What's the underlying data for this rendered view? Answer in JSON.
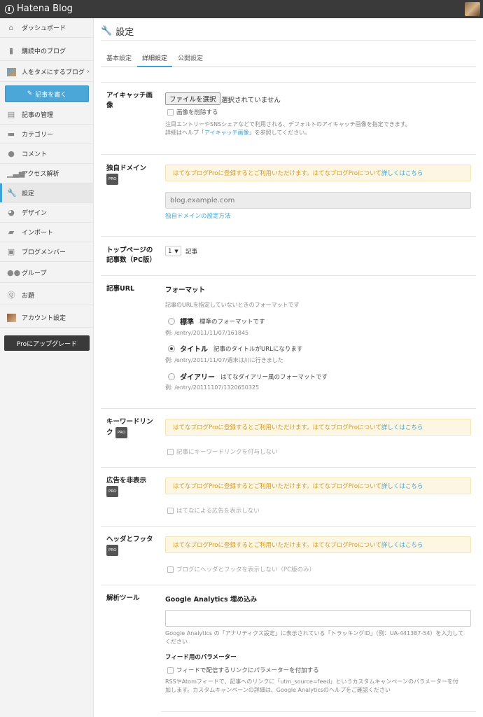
{
  "app": {
    "logo_text": "Hatena Blog"
  },
  "sidebar": {
    "dashboard": "ダッシュボード",
    "subscribed": "購読中のブログ",
    "blog_name": "人をタメにするブログ",
    "write_button": "記事を書く",
    "items": [
      "記事の管理",
      "カテゴリー",
      "コメント",
      "アクセス解析",
      "設定",
      "デザイン",
      "インポート",
      "ブログメンバー",
      "グループ",
      "お題",
      "アカウント設定"
    ],
    "pro_button": "Proにアップグレード"
  },
  "page": {
    "title": "設定",
    "tabs": [
      "基本設定",
      "詳細設定",
      "公開設定"
    ],
    "active_tab": "詳細設定"
  },
  "eyecatch": {
    "label": "アイキャッチ画像",
    "file_button": "ファイルを選択",
    "file_status": "選択されていません",
    "delete_checkbox": "画像を削除する",
    "note_line1": "注目エントリーやSNSシェアなどで利用される、デフォルトのアイキャッチ画像を指定できます。",
    "note_line2_pre": "詳細はヘルプ「",
    "note_link": "アイキャッチ画像",
    "note_line2_post": "」を参照してください。"
  },
  "pro_badge": "PRO",
  "pro_notice": {
    "text": "はてなブログProに登録するとご利用いただけます。はてなブログProについて",
    "link": "詳しくはこちら"
  },
  "domain": {
    "label": "独自ドメイン",
    "placeholder": "blog.example.com",
    "help_link": "独自ドメインの設定方法"
  },
  "top_count": {
    "label_line1": "トップページの",
    "label_line2": "記事数（PC版）",
    "value": "1",
    "unit": "記事"
  },
  "url": {
    "label": "記事URL",
    "heading": "フォーマット",
    "desc": "記事のURLを指定していないときのフォーマットです",
    "options": [
      {
        "name": "標準",
        "desc": "標準のフォーマットです",
        "example": "例: /entry/2011/11/07/161845"
      },
      {
        "name": "タイトル",
        "desc": "記事のタイトルがURLになります",
        "example": "例: /entry/2011/11/07/週末は川に行きました"
      },
      {
        "name": "ダイアリー",
        "desc": "はてなダイアリー風のフォーマットです",
        "example": "例: /entry/20111107/1320650325"
      }
    ],
    "selected": "タイトル"
  },
  "keyword": {
    "label_line1": "キーワードリン",
    "label_line2": "ク",
    "checkbox": "記事にキーワードリンクを付与しない"
  },
  "ads": {
    "label": "広告を非表示",
    "checkbox": "はてなによる広告を表示しない"
  },
  "header_footer": {
    "label": "ヘッダとフッタ",
    "checkbox": "ブログにヘッダとフッタを表示しない（PC版のみ）"
  },
  "analytics": {
    "label": "解析ツール",
    "ga_heading": "Google Analytics 埋め込み",
    "ga_note_line1": "Google Analytics の「アナリティクス設定」に表示されている「トラッキングID」（例：UA-441387-54）を入力して",
    "ga_note_line2": "ください",
    "feed_heading": "フィード用のパラメーター",
    "feed_checkbox": "フィードで配信するリンクにパラメーターを付加する",
    "feed_note_line1": "RSSやAtomフィードで、記事へのリンクに「utm_source=feed」というカスタムキャンペーンのパラメーターを付",
    "feed_note_line2": "加します。カスタムキャンペーンの詳細は、Google Analyticsのヘルプをご確認ください"
  },
  "colors": {
    "accent": "#3aa4d9",
    "topbar": "#3a3a3a",
    "notice_bg": "#fdf6e3",
    "notice_text": "#d59b2b"
  }
}
